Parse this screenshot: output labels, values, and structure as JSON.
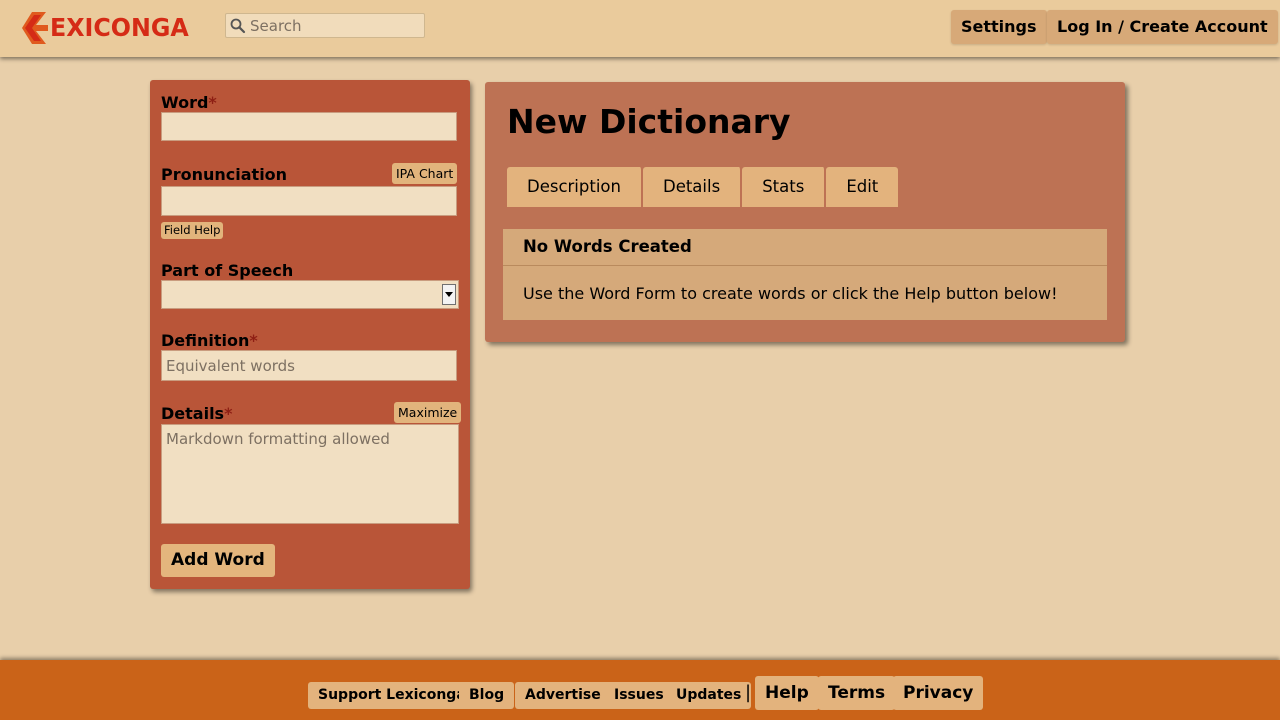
{
  "header": {
    "logo_text": "EXICONGA",
    "search_placeholder": "Search",
    "settings_label": "Settings",
    "login_label": "Log In / Create Account"
  },
  "word_form": {
    "word_label": "Word",
    "required_mark": "*",
    "pronunciation_label": "Pronunciation",
    "ipa_chart_label": "IPA Chart",
    "field_help_label": "Field Help",
    "part_of_speech_label": "Part of Speech",
    "part_of_speech_value": "",
    "definition_label": "Definition",
    "definition_placeholder": "Equivalent words",
    "details_label": "Details",
    "maximize_label": "Maximize",
    "details_placeholder": "Markdown formatting allowed",
    "add_word_label": "Add Word"
  },
  "dictionary": {
    "title": "New Dictionary",
    "tabs": [
      {
        "label": "Description"
      },
      {
        "label": "Details"
      },
      {
        "label": "Stats"
      },
      {
        "label": "Edit"
      }
    ],
    "entries_title": "No Words Created",
    "entries_message": "Use the Word Form to create words or click the Help button below!"
  },
  "footer": {
    "support_label": "Support Lexiconga",
    "blog_label": "Blog",
    "advertise_label": "Advertise",
    "issues_label": "Issues",
    "updates_label": "Updates",
    "separator": "|",
    "help_label": "Help",
    "terms_label": "Terms",
    "privacy_label": "Privacy"
  },
  "colors": {
    "background": "#e8cfaa",
    "header": "#eacb9c",
    "form_panel": "#b95538",
    "dictionary_panel": "#bd7254",
    "button": "#e3b37d",
    "footer": "#ca6318",
    "logo": "#d52b16"
  }
}
